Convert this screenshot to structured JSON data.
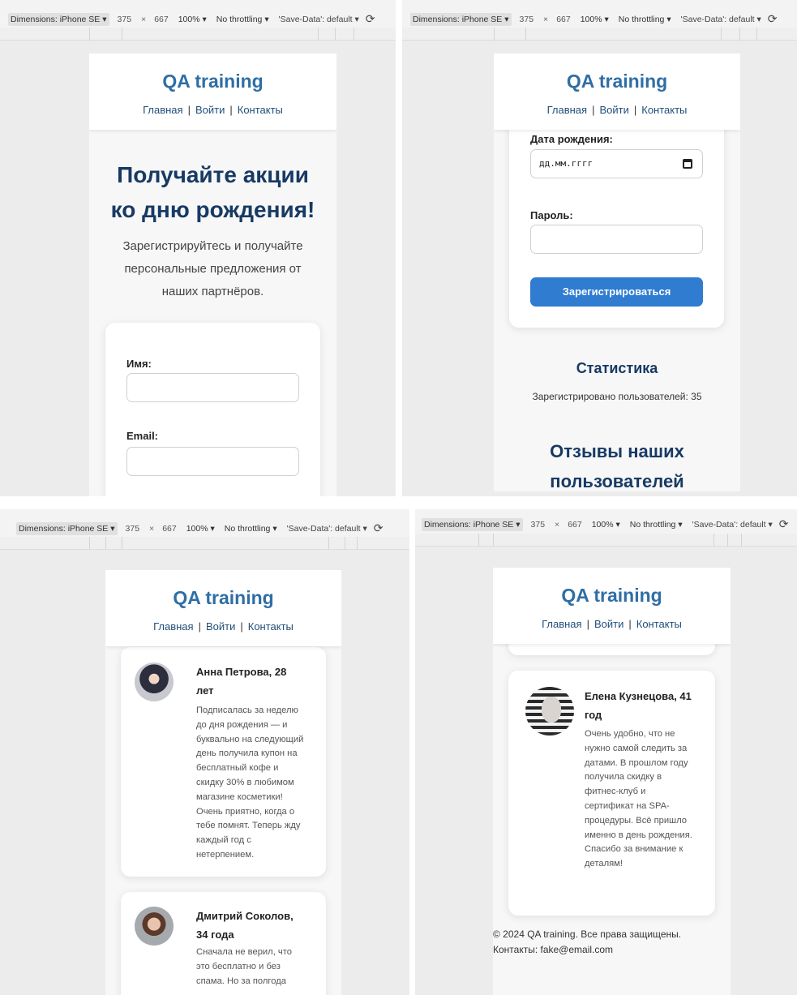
{
  "devtools": {
    "dimensions_label": "Dimensions: iPhone SE",
    "width": "375",
    "times": "×",
    "height": "667",
    "zoom": "100%",
    "throttling": "No throttling",
    "save_data": "'Save-Data': default",
    "dropdown_arrow": "▾",
    "rotate_glyph": "⟳"
  },
  "site": {
    "logo": "QA training",
    "nav": [
      "Главная",
      "Войти",
      "Контакты"
    ],
    "nav_separator": "|"
  },
  "hero": {
    "title_line1": "Получайте акции",
    "title_line2": "ко дню рождения!",
    "subtitle_line1": "Зарегистрируйтесь и получайте",
    "subtitle_line2": "персональные предложения от",
    "subtitle_line3": "наших партнёров."
  },
  "form": {
    "name_label": "Имя:",
    "email_label": "Email:",
    "birthdate_label": "Дата рождения:",
    "birthdate_placeholder": "дд.мм.гггг",
    "password_label": "Пароль:",
    "submit_label": "Зарегистрироваться"
  },
  "stats": {
    "title": "Статистика",
    "text": "Зарегистрировано пользователей: 35"
  },
  "reviews": {
    "title_line1": "Отзывы наших",
    "title_line2": "пользователей",
    "items": [
      {
        "name_line1": "Анна Петрова, 28",
        "name_line2": "лет",
        "body": [
          "Подписалась за неделю",
          "до дня рождения — и",
          "буквально на следующий",
          "день получила купон на",
          "бесплатный кофе и",
          "скидку 30% в любимом",
          "магазине косметики!",
          "Очень приятно, когда о",
          "тебе помнят. Теперь жду",
          "каждый год с",
          "нетерпением."
        ]
      },
      {
        "name_line1": "Дмитрий Соколов,",
        "name_line2": "34 года",
        "body": [
          "Сначала не верил, что",
          "это бесплатно и без",
          "спама. Но за полгода"
        ]
      },
      {
        "name_line1": "Елена Кузнецова, 41",
        "name_line2": "год",
        "body": [
          "Очень удобно, что не",
          "нужно самой следить за",
          "датами. В прошлом году",
          "получила скидку в",
          "фитнес-клуб и",
          "сертификат на SPA-",
          "процедуры. Всё пришло",
          "именно в день рождения.",
          "Спасибо за внимание к",
          "деталям!"
        ]
      }
    ]
  },
  "footer": {
    "copyright": "© 2024 QA training. Все права защищены.",
    "contacts": "Контакты: fake@email.com"
  }
}
